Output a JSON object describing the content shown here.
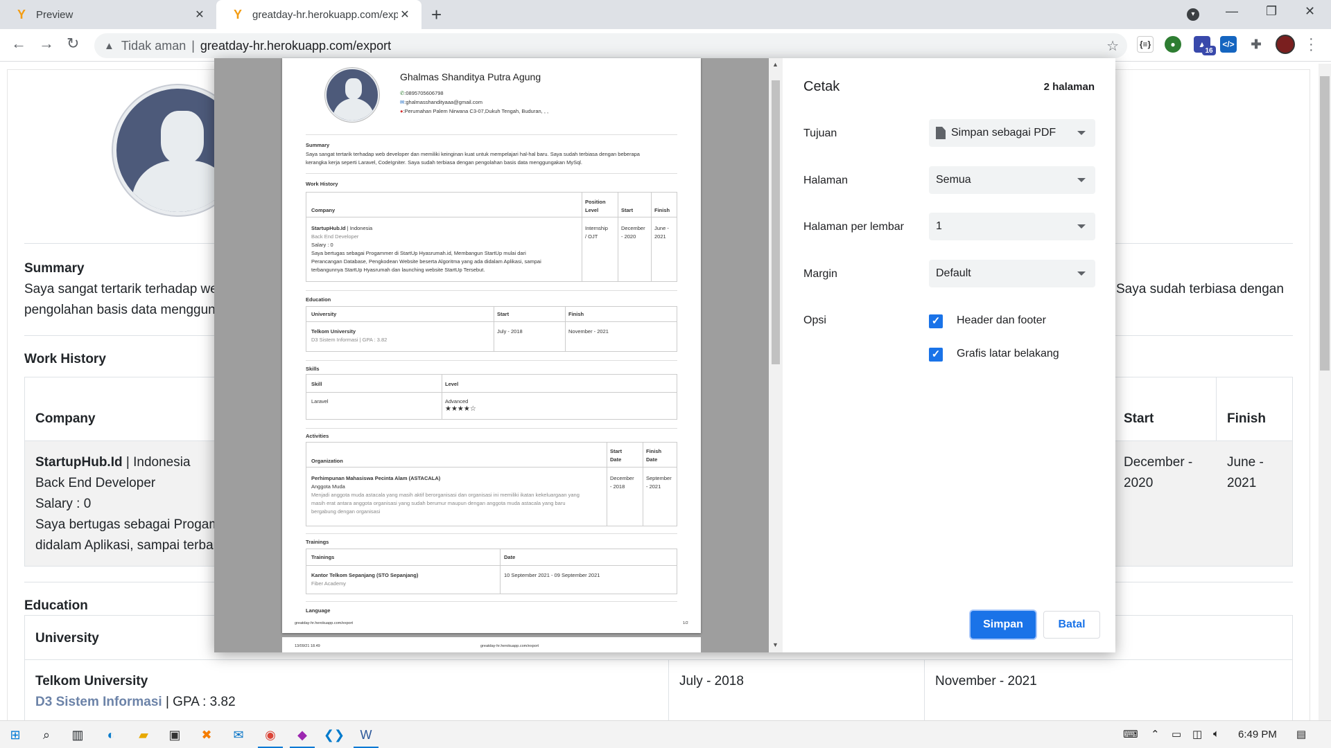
{
  "browser": {
    "tabs": [
      {
        "title": "Preview",
        "favicon": "greatday-y-icon"
      },
      {
        "title": "greatday-hr.herokuapp.com/expo",
        "favicon": "greatday-y-icon"
      }
    ],
    "address": {
      "not_secure": "Tidak aman",
      "separator": "|",
      "url": "greatday-hr.herokuapp.com/export"
    },
    "extension_badge": "16"
  },
  "page": {
    "summary_heading": "Summary",
    "summary_line1_left": "Saya sangat tertarik terhadap we",
    "summary_line1_right": "Saya sudah terbiasa dengan",
    "summary_line2_left": "pengolahan basis data menggung",
    "work_heading": "Work History",
    "work_headers": {
      "company": "Company",
      "start": "Start",
      "finish": "Finish"
    },
    "work_row": {
      "company": "StartupHub.Id",
      "sep_country": "| Indonesia",
      "position": "Back End Developer",
      "salary": "Salary : 0",
      "desc1": "Saya bertugas sebagai Progamr",
      "desc2": "didalam Aplikasi, sampai terbar",
      "start1": "December -",
      "start2": "2020",
      "finish1": "June -",
      "finish2": "2021"
    },
    "edu_heading": "Education",
    "edu_headers": {
      "university": "University"
    },
    "edu_row": {
      "university": "Telkom University",
      "major": "D3 Sistem Informasi",
      "gpa": "| GPA : 3.82",
      "start": "July - 2018",
      "finish": "November - 2021"
    }
  },
  "preview": {
    "name": "Ghalmas Shanditya Putra Agung",
    "phone": ":0895705606798",
    "email": ":ghalmasshandityaaa@gmail.com",
    "address": ":Perumahan Palem Nirwana C3-07,Dukuh Tengah, Buduran, , ,",
    "summary_heading": "Summary",
    "summary_line1": "Saya sangat tertarik terhadap web developer dan memiliki keinginan kuat untuk mempelajari hal-hal baru. Saya sudah terbiasa dengan beberapa",
    "summary_line2": "kerangka kerja seperti Laravel, CodeIgniter. Saya sudah terbiasa dengan pengolahan basis data menggungakan MySql.",
    "work_heading": "Work History",
    "work_headers": {
      "company": "Company",
      "position1": "Position",
      "position2": "Level",
      "start": "Start",
      "finish": "Finish"
    },
    "work_row": {
      "company": "StartupHub.Id",
      "country": "| Indonesia",
      "position": "Back End Developer",
      "salary": "Salary : 0",
      "desc1": "Saya bertugas sebagai Progammer di StartUp Hyasrumah.id, Membangun StartUp mulai dari",
      "desc2": "Perancangan Database, Pengkodean Website beserta Algoritma yang ada didalam Aplikasi, sampai",
      "desc3": "terbangunnya StartUp Hyasrumah dan launching website StartUp Tersebut.",
      "level1": "Internship",
      "level2": "/ OJT",
      "start1": "December",
      "start2": "- 2020",
      "finish1": "June -",
      "finish2": "2021"
    },
    "edu_heading": "Education",
    "edu_headers": {
      "university": "University",
      "start": "Start",
      "finish": "Finish"
    },
    "edu_row": {
      "university": "Telkom University",
      "major": "D3 Sistem Informasi | GPA : 3.82",
      "start": "July - 2018",
      "finish": "November - 2021"
    },
    "skills_heading": "Skills",
    "skills_headers": {
      "skill": "Skill",
      "level": "Level"
    },
    "skills_row": {
      "skill": "Laravel",
      "level": "Advanced",
      "stars": "★★★★☆"
    },
    "activities_heading": "Activities",
    "activities_headers": {
      "org": "Organization",
      "start1": "Start",
      "start2": "Date",
      "finish1": "Finish",
      "finish2": "Date"
    },
    "activities_row": {
      "org": "Perhimpunan Mahasiswa Pecinta Alam (ASTACALA)",
      "role": "Anggota Muda",
      "desc1": "Menjadi anggota muda astacala yang masih aktif berorganisasi dan organisasi ini memiliki ikatan kekeluargaan yang",
      "desc2": "masih erat antara anggota organisasi yang sudah berumur maupun dengan anggota muda astacala yang baru",
      "desc3": "bergabung dengan organisasi",
      "start1": "December",
      "start2": "- 2018",
      "finish1": "September",
      "finish2": "- 2021"
    },
    "trainings_heading": "Trainings",
    "trainings_headers": {
      "training": "Trainings",
      "date": "Date"
    },
    "trainings_row": {
      "name": "Kantor Telkom Sepanjang (STO Sepanjang)",
      "org": "Fiber Academy",
      "date": "10 September 2021 - 09 September 2021"
    },
    "language_heading": "Language",
    "footer_url": "greatday-hr.herokuapp.com/export",
    "footer_page": "1/2",
    "page2_date": "13/09/21 18.49",
    "page2_url": "greatday-hr.herokuapp.com/export"
  },
  "print": {
    "title": "Cetak",
    "pages": "2 halaman",
    "destination_label": "Tujuan",
    "destination_value": "Simpan sebagai PDF",
    "pages_label": "Halaman",
    "pages_value": "Semua",
    "per_sheet_label": "Halaman per lembar",
    "per_sheet_value": "1",
    "margin_label": "Margin",
    "margin_value": "Default",
    "options_label": "Opsi",
    "opt_header_footer": "Header dan footer",
    "opt_background": "Grafis latar belakang",
    "save_button": "Simpan",
    "cancel_button": "Batal"
  },
  "taskbar": {
    "time": "6:49 PM"
  },
  "colors": {
    "accent": "#1a73e8",
    "avatar_bg": "#4d5a7a",
    "muted_link": "#6c83a8"
  }
}
